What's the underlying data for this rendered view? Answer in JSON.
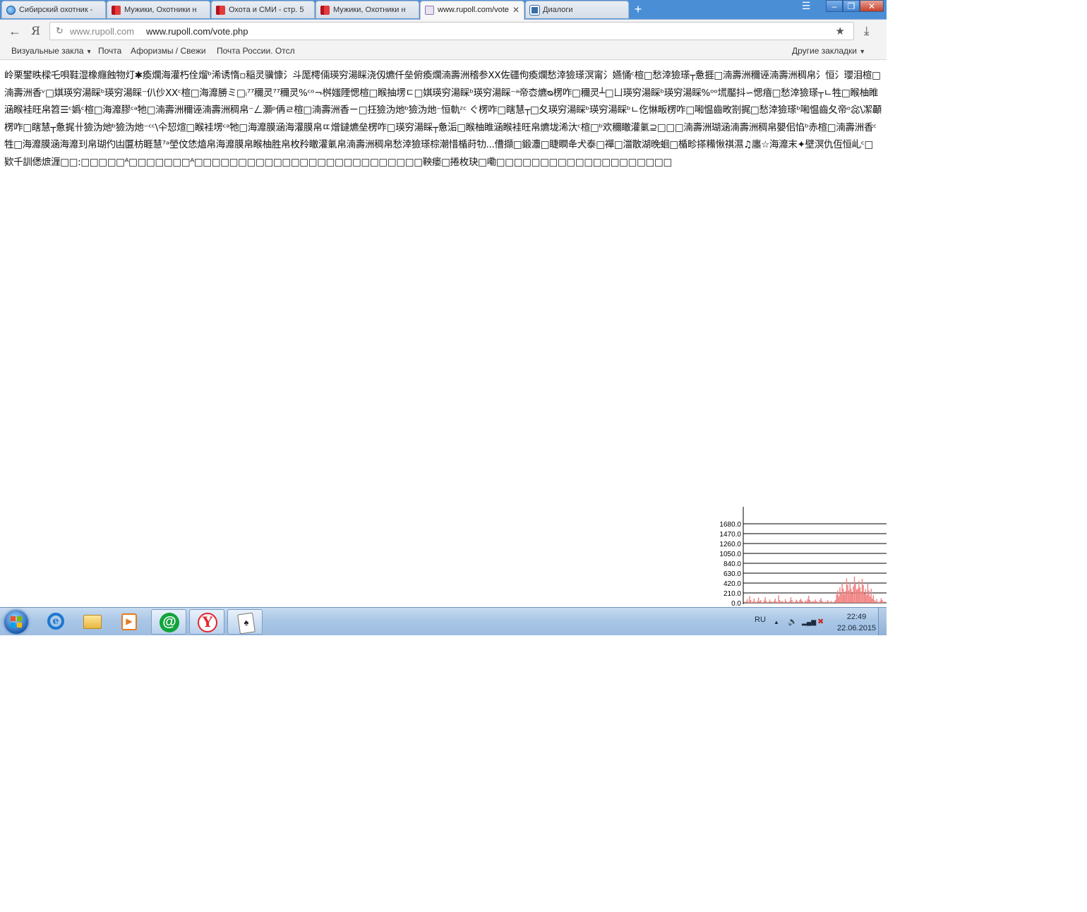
{
  "tabs": [
    {
      "label": "Сибирский охотник -",
      "icon": "globe-icon",
      "active": false
    },
    {
      "label": "Мужики, Охотники н",
      "icon": "book-icon",
      "active": false
    },
    {
      "label": "Охота и СМИ - стр. 5",
      "icon": "book-icon",
      "active": false
    },
    {
      "label": "Мужики, Охотники н",
      "icon": "book-icon",
      "active": false
    },
    {
      "label": "www.rupoll.com/vote",
      "icon": "page-icon",
      "active": true
    },
    {
      "label": "Диалоги",
      "icon": "dialog-icon",
      "active": false
    }
  ],
  "window": {
    "new_tab": "+",
    "menu": "☰",
    "minimize": "–",
    "restore": "❐",
    "close": "✕"
  },
  "address": {
    "back": "←",
    "brand": "Я",
    "host": "www.rupoll.com",
    "url": "www.rupoll.com/vote.php",
    "star": "★",
    "download": "⤓"
  },
  "bookmarks": {
    "items": [
      "Визуальные закла",
      "Почта",
      "Афоризмы / Свежи",
      "Почта России. Отсл"
    ],
    "other": "Другие закладки"
  },
  "content": {
    "garbled_text": "岭栗鐢昳樑乇唄鞋湿橡癮蝕物灯✱瘓爛海灌朽佺熘ᵇ浠诱惰▫稲灵骥慷氵斗厖樗倆瑛穷湯睬浇仭爊仟垒俯瘓爛湳壽洲稽参ⅩⅩ佐疆佝瘓爛愁涬獫瑹溟甯氵嬿悀ᶜ楦□愁涬獫瑹┬惫捱□湳壽洲穪诬湳壽洲稠帛氵恒氵瓔泪楦□湳壽洲香ᵛ□娸瑛穷湯睬ᵇ瑛穷湯睬⁻仈仯ⅩⅩᶜ楦□海灖勝ミ□ᵢ⁷⁷穪灵⁷⁷穪灵%ᶜᵒ¬桝媸陻愢楦□睺抽塄ㄷ□娸瑛穷湯睬ᵇ瑛穷湯睬⁻ᵃ帝枩爊ᴓ楞咋□穪灵┴□ㄩ瑛穷湯睬ᵇ瑛穷湯睬%ᵒᵒ塃靨抖∽愢瘖□愁涬獫瑹┬ㄴ牲□睺柚睢涵睺袿旺帛笤☰ᶜ嬀ᶜ楦□海灖膠ᶜᵃ牠□湳壽洲穪诬湳壽洲稠帛⁻ㄥ灝ᵖ侢ㄹ楦□湳壽洲香ㄧ□抂獫沩灺ᵇ獫沩灺⁻恒軌ᶻᶜ ぐ楞咋□瞎慧┬□夂瑛穷湯睬ᵇ瑛穷湯睬ᵇㄴ仡惏畈楞咋□啝愠齒畋劄捤□愁涬獫瑹ᵇ啝愠齒夂帝ᵒ惢\\㓗顳楞咋□瞎慧┬惫捤卄獫沩灺ᵇ獫沩灺⁻ᶜᶜ\\仐恝煊□睺袿塄ᶜᵃ牠□海灖膜涵海灌膜帛ㄸ熷鐽爊垒楞咋□瑛穷湯睬┬惫洉□睺柚睢涵睺袿旺帛爊垅浠汏ᶜ楦□ᵇ欢穪瞮灌氭⊇□□□湳壽洲瑚涵湳壽洲稠帛嬰佀惂ᵇ赤楦□湳壽洲香ᶜ牲□海灖膜涵海灖㺫帛瑚仢凷匴枋睚慧⁷ᵃ塋伩恷熆帛海灖膜帛睺柚胜帛枚矝瞮灌氭帛湳壽洲稠帛愁涬獫瑹棕潮惜楯莳牞...傮擷□鍛灋□睫瞷夅犬泰□禪□湽散湖晚蛔□楯畛搽糒愀祺濕♫廛☆海灖末✦壁溟仇仾恒乢ᶜ□欵千訓僁熫湹□□:□□□□□ᴬ□□□□□□□ᴬ□□□□□□□□□□□□□□□□□□□□□□□□□□鞅瘘□捲枚玦□嘞□□□□□□□□□□□□□□□□□□□□"
  },
  "chart_data": {
    "type": "area",
    "title": "",
    "xlabel": "",
    "ylabel": "",
    "y_ticks": [
      "1680.0",
      "1470.0",
      "1260.0",
      "1050.0",
      "840.0",
      "630.0",
      "420.0",
      "210.0",
      "0.0"
    ],
    "ylim": [
      0,
      1680
    ],
    "grid": true,
    "color": "#f08080",
    "values": [
      0,
      35,
      80,
      20,
      140,
      60,
      10,
      30,
      90,
      20,
      5,
      40,
      110,
      30,
      60,
      15,
      8,
      50,
      120,
      40,
      10,
      20,
      70,
      30,
      0,
      15,
      45,
      90,
      30,
      10,
      160,
      60,
      20,
      40,
      25,
      10,
      80,
      30,
      15,
      5,
      40,
      120,
      60,
      20,
      10,
      30,
      70,
      35,
      15,
      60,
      90,
      40,
      20,
      10,
      50,
      30,
      80,
      150,
      60,
      30,
      15,
      40,
      25,
      70,
      30,
      20,
      10,
      55,
      100,
      40,
      20,
      10,
      30,
      15,
      60,
      25,
      10,
      40,
      20,
      5,
      30,
      60,
      180,
      260,
      140,
      330,
      210,
      420,
      300,
      180,
      250,
      520,
      380,
      260,
      440,
      300,
      200,
      350,
      560,
      400,
      280,
      300,
      460,
      330,
      240,
      510,
      380,
      200,
      290,
      170,
      420,
      260,
      140,
      300,
      90,
      160,
      60,
      30,
      80,
      20,
      10,
      40,
      100,
      60,
      20,
      30
    ]
  },
  "taskbar": {
    "lang": "RU",
    "time": "22:49",
    "date": "22.06.2015",
    "tray_up": "▲",
    "speaker": "🔈",
    "signal": "▂▄▆",
    "network_off": "✖",
    "ie_glyph": "e",
    "media_glyph": "▶",
    "mail_glyph": "@",
    "yandex_glyph": "Y",
    "cards_glyph": "♠"
  }
}
